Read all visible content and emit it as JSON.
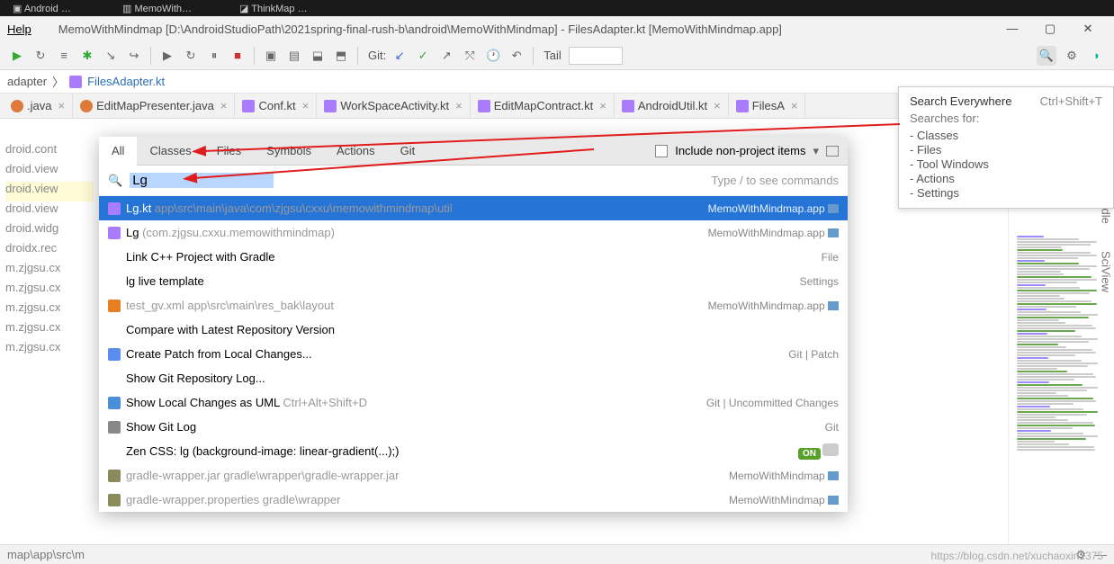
{
  "menu": {
    "help": "Help",
    "title": "MemoWithMindmap [D:\\AndroidStudioPath\\2021spring-final-rush-b\\android\\MemoWithMindmap] - FilesAdapter.kt [MemoWithMindmap.app]"
  },
  "toolbar": {
    "git_label": "Git:",
    "tail": "Tail"
  },
  "breadcrumb": {
    "parent": "adapter",
    "file": "FilesAdapter.kt"
  },
  "editor_tabs": [
    {
      "icon": "java",
      "label": ".java"
    },
    {
      "icon": "java",
      "label": "EditMapPresenter.java"
    },
    {
      "icon": "kt",
      "label": "Conf.kt"
    },
    {
      "icon": "kt",
      "label": "WorkSpaceActivity.kt"
    },
    {
      "icon": "kt",
      "label": "EditMapContract.kt"
    },
    {
      "icon": "kt",
      "label": "AndroidUtil.kt"
    },
    {
      "icon": "kt",
      "label": "FilesA"
    }
  ],
  "gutter_lines": [
    "",
    "droid.cont",
    "droid.view",
    "droid.view",
    "droid.view",
    "droid.widg",
    "droidx.rec",
    "m.zjgsu.cx",
    "m.zjgsu.cx",
    "m.zjgsu.cx",
    "m.zjgsu.cx",
    "m.zjgsu.cx"
  ],
  "gutter_highlight_index": 3,
  "popup": {
    "tabs": [
      "All",
      "Classes",
      "Files",
      "Symbols",
      "Actions",
      "Git"
    ],
    "active_tab": 0,
    "include_label": "Include non-project items",
    "search_value": "Lg",
    "hint": "Type / to see commands",
    "rows": [
      {
        "icon": "kt",
        "main": "Lg.kt",
        "sub": " app\\src\\main\\java\\com\\zjgsu\\cxxu\\memowithmindmap\\util",
        "loc": "MemoWithMindmap.app",
        "loc_icon": "folder",
        "selected": true
      },
      {
        "icon": "kt",
        "main": "Lg",
        "sub": " (com.zjgsu.cxxu.memowithmindmap)",
        "loc": "MemoWithMindmap.app",
        "loc_icon": "folder"
      },
      {
        "main": "Link C++ Project with Gradle",
        "loc": "File"
      },
      {
        "main": "lg live template",
        "loc": "Settings"
      },
      {
        "icon": "xml",
        "main": "test_gv.xml",
        "sub": " app\\src\\main\\res_bak\\layout",
        "loc": "MemoWithMindmap.app",
        "loc_icon": "folder",
        "muted": true
      },
      {
        "main": "Compare with Latest Repository Version"
      },
      {
        "icon": "diff",
        "main": "Create Patch from Local Changes...",
        "loc": "Git | Patch"
      },
      {
        "main": "Show Git Repository Log..."
      },
      {
        "icon": "uml",
        "main": "Show Local Changes as UML",
        "shortcut": "Ctrl+Alt+Shift+D",
        "loc": "Git | Uncommitted Changes"
      },
      {
        "icon": "log",
        "main": "Show Git Log",
        "loc": "Git"
      },
      {
        "main": "Zen CSS: lg (background-image: linear-gradient(...);)",
        "toggle": "ON"
      },
      {
        "icon": "jar",
        "main": "gradle-wrapper.jar",
        "sub": " gradle\\wrapper\\gradle-wrapper.jar",
        "loc": "MemoWithMindmap",
        "loc_icon": "folder",
        "muted": true
      },
      {
        "icon": "jar",
        "main": "gradle-wrapper.properties",
        "sub": " gradle\\wrapper",
        "loc": "MemoWithMindmap",
        "loc_icon": "folder",
        "muted": true
      }
    ]
  },
  "tip": {
    "title": "Search Everywhere",
    "shortcut": "Ctrl+Shift+T",
    "sub": "Searches for:",
    "items": [
      "- Classes",
      "- Files",
      "- Tool Windows",
      "- Actions",
      "- Settings"
    ]
  },
  "statusbar": {
    "left": "map\\app\\src\\m"
  },
  "watermark": "https://blog.csdn.net/xuchaoxin1375",
  "side_tabs": [
    "radle",
    "SciView"
  ]
}
